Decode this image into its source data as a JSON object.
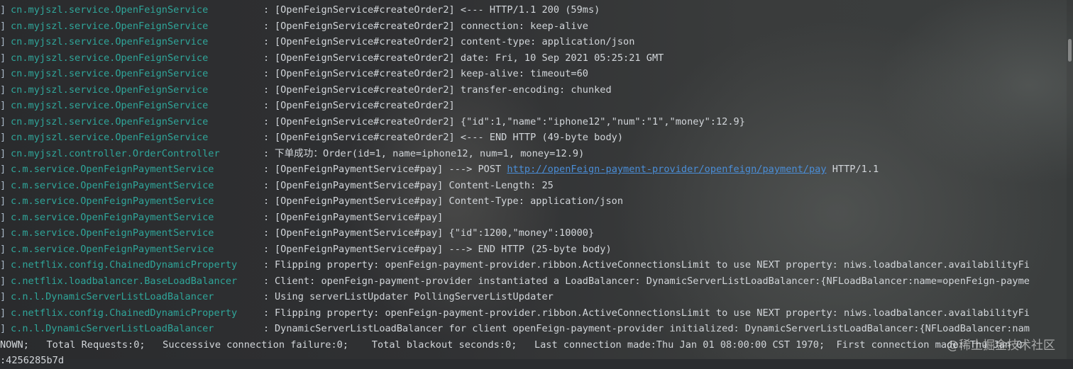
{
  "console": {
    "lines": [
      {
        "logger": "cn.myjszl.service.OpenFeignService",
        "message": "[OpenFeignService#createOrder2] <--- HTTP/1.1 200 (59ms)"
      },
      {
        "logger": "cn.myjszl.service.OpenFeignService",
        "message": "[OpenFeignService#createOrder2] connection: keep-alive"
      },
      {
        "logger": "cn.myjszl.service.OpenFeignService",
        "message": "[OpenFeignService#createOrder2] content-type: application/json"
      },
      {
        "logger": "cn.myjszl.service.OpenFeignService",
        "message": "[OpenFeignService#createOrder2] date: Fri, 10 Sep 2021 05:25:21 GMT"
      },
      {
        "logger": "cn.myjszl.service.OpenFeignService",
        "message": "[OpenFeignService#createOrder2] keep-alive: timeout=60"
      },
      {
        "logger": "cn.myjszl.service.OpenFeignService",
        "message": "[OpenFeignService#createOrder2] transfer-encoding: chunked"
      },
      {
        "logger": "cn.myjszl.service.OpenFeignService",
        "message": "[OpenFeignService#createOrder2]"
      },
      {
        "logger": "cn.myjszl.service.OpenFeignService",
        "message": "[OpenFeignService#createOrder2] {\"id\":1,\"name\":\"iphone12\",\"num\":\"1\",\"money\":12.9}"
      },
      {
        "logger": "cn.myjszl.service.OpenFeignService",
        "message": "[OpenFeignService#createOrder2] <--- END HTTP (49-byte body)"
      },
      {
        "logger": "cn.myjszl.controller.OrderController",
        "message": "下单成功：Order(id=1, name=iphone12, num=1, money=12.9)"
      },
      {
        "logger": "c.m.service.OpenFeignPaymentService",
        "message_prefix": "[OpenFeignPaymentService#pay] ---> POST ",
        "link": "http://openFeign-payment-provider/openfeign/payment/pay",
        "message_suffix": " HTTP/1.1"
      },
      {
        "logger": "c.m.service.OpenFeignPaymentService",
        "message": "[OpenFeignPaymentService#pay] Content-Length: 25"
      },
      {
        "logger": "c.m.service.OpenFeignPaymentService",
        "message": "[OpenFeignPaymentService#pay] Content-Type: application/json"
      },
      {
        "logger": "c.m.service.OpenFeignPaymentService",
        "message": "[OpenFeignPaymentService#pay]"
      },
      {
        "logger": "c.m.service.OpenFeignPaymentService",
        "message": "[OpenFeignPaymentService#pay] {\"id\":1200,\"money\":10000}"
      },
      {
        "logger": "c.m.service.OpenFeignPaymentService",
        "message": "[OpenFeignPaymentService#pay] ---> END HTTP (25-byte body)"
      },
      {
        "logger": "c.netflix.config.ChainedDynamicProperty",
        "message": "Flipping property: openFeign-payment-provider.ribbon.ActiveConnectionsLimit to use NEXT property: niws.loadbalancer.availabilityFi"
      },
      {
        "logger": "c.netflix.loadbalancer.BaseLoadBalancer",
        "message": "Client: openFeign-payment-provider instantiated a LoadBalancer: DynamicServerListLoadBalancer:{NFLoadBalancer:name=openFeign-payme"
      },
      {
        "logger": "c.n.l.DynamicServerListLoadBalancer",
        "message": "Using serverListUpdater PollingServerListUpdater"
      },
      {
        "logger": "c.netflix.config.ChainedDynamicProperty",
        "message": "Flipping property: openFeign-payment-provider.ribbon.ActiveConnectionsLimit to use NEXT property: niws.loadbalancer.availabilityFi"
      },
      {
        "logger": "c.n.l.DynamicServerListLoadBalancer",
        "message": "DynamicServerListLoadBalancer for client openFeign-payment-provider initialized: DynamicServerListLoadBalancer:{NFLoadBalancer:nam"
      }
    ],
    "bracket": "]",
    "colon": ":",
    "status_line": "NOWN;   Total Requests:0;   Successive connection failure:0;    Total blackout seconds:0;   Last connection made:Thu Jan 01 08:00:00 CST 1970;  First connection made: Thu Jan 0",
    "wrap_line": ":4256285b7d"
  },
  "watermark": "@稀土掘金技术社区",
  "colors": {
    "logger": "#2fa69a",
    "message": "#d2d6da",
    "link": "#4a8ed8",
    "background": "#2b2d30"
  }
}
